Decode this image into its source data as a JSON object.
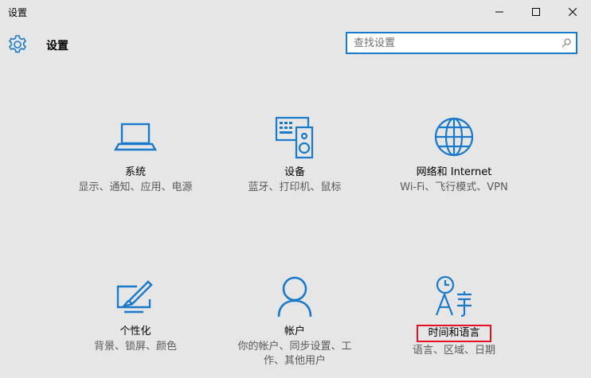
{
  "window": {
    "title": "设置",
    "minimize_icon": "minimize-icon",
    "maximize_icon": "maximize-icon",
    "close_icon": "close-icon"
  },
  "header": {
    "icon": "gear-icon",
    "title": "设置"
  },
  "search": {
    "placeholder": "查找设置",
    "value": "",
    "icon": "search-icon",
    "border_color": "#1979ca"
  },
  "accent_color": "#1979ca",
  "highlight_color": "#e81123",
  "tiles": [
    {
      "name": "system",
      "label": "系统",
      "desc": "显示、通知、应用、电源",
      "icon": "laptop-icon"
    },
    {
      "name": "devices",
      "label": "设备",
      "desc": "蓝牙、打印机、鼠标",
      "icon": "keyboard-speaker-icon"
    },
    {
      "name": "network",
      "label": "网络和 Internet",
      "desc": "Wi-Fi、飞行模式、VPN",
      "icon": "globe-icon"
    },
    {
      "name": "personalization",
      "label": "个性化",
      "desc": "背景、锁屏、颜色",
      "icon": "paint-screen-icon"
    },
    {
      "name": "accounts",
      "label": "帐户",
      "desc": "你的帐户、同步设置、工作、其他用户",
      "icon": "person-icon"
    },
    {
      "name": "time-language",
      "label": "时间和语言",
      "desc": "语言、区域、日期",
      "icon": "time-language-icon",
      "highlighted": true
    }
  ]
}
